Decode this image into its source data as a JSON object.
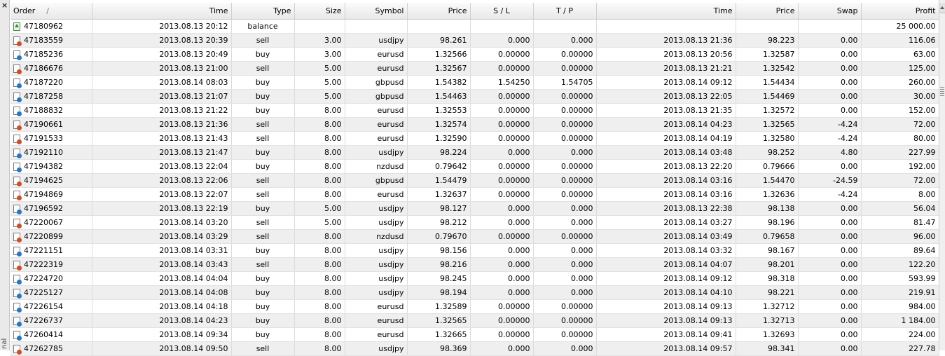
{
  "panel": {
    "close_glyph": "×",
    "side_label": "nal"
  },
  "columns": [
    "Order",
    "Time",
    "Type",
    "Size",
    "Symbol",
    "Price",
    "S / L",
    "T / P",
    "Time",
    "Price",
    "Swap",
    "Profit"
  ],
  "sort_indicator": "/",
  "rows": [
    {
      "icon": "balance",
      "order": "47180962",
      "open_time": "2013.08.13 20:12",
      "type": "balance",
      "size": "",
      "symbol": "",
      "open_price": "",
      "sl": "",
      "tp": "",
      "close_time": "",
      "close_price": "",
      "swap": "",
      "profit": "25 000.00"
    },
    {
      "icon": "sell",
      "order": "47183559",
      "open_time": "2013.08.13 20:39",
      "type": "sell",
      "size": "3.00",
      "symbol": "usdjpy",
      "open_price": "98.261",
      "sl": "0.000",
      "tp": "0.000",
      "close_time": "2013.08.13 21:36",
      "close_price": "98.223",
      "swap": "0.00",
      "profit": "116.06"
    },
    {
      "icon": "buy",
      "order": "47185236",
      "open_time": "2013.08.13 20:49",
      "type": "buy",
      "size": "3.00",
      "symbol": "eurusd",
      "open_price": "1.32566",
      "sl": "0.00000",
      "tp": "0.00000",
      "close_time": "2013.08.13 20:56",
      "close_price": "1.32587",
      "swap": "0.00",
      "profit": "63.00"
    },
    {
      "icon": "sell",
      "order": "47186676",
      "open_time": "2013.08.13 21:00",
      "type": "sell",
      "size": "5.00",
      "symbol": "eurusd",
      "open_price": "1.32567",
      "sl": "0.00000",
      "tp": "0.00000",
      "close_time": "2013.08.13 21:21",
      "close_price": "1.32542",
      "swap": "0.00",
      "profit": "125.00"
    },
    {
      "icon": "buy",
      "order": "47187220",
      "open_time": "2013.08.14 08:03",
      "type": "buy",
      "size": "5.00",
      "symbol": "gbpusd",
      "open_price": "1.54382",
      "sl": "1.54250",
      "tp": "1.54705",
      "close_time": "2013.08.14 09:12",
      "close_price": "1.54434",
      "swap": "0.00",
      "profit": "260.00"
    },
    {
      "icon": "buy",
      "order": "47187258",
      "open_time": "2013.08.13 21:07",
      "type": "buy",
      "size": "5.00",
      "symbol": "gbpusd",
      "open_price": "1.54463",
      "sl": "0.00000",
      "tp": "0.00000",
      "close_time": "2013.08.13 22:05",
      "close_price": "1.54469",
      "swap": "0.00",
      "profit": "30.00"
    },
    {
      "icon": "buy",
      "order": "47188832",
      "open_time": "2013.08.13 21:22",
      "type": "buy",
      "size": "8.00",
      "symbol": "eurusd",
      "open_price": "1.32553",
      "sl": "0.00000",
      "tp": "0.00000",
      "close_time": "2013.08.13 21:35",
      "close_price": "1.32572",
      "swap": "0.00",
      "profit": "152.00"
    },
    {
      "icon": "sell",
      "order": "47190661",
      "open_time": "2013.08.13 21:36",
      "type": "sell",
      "size": "8.00",
      "symbol": "eurusd",
      "open_price": "1.32574",
      "sl": "0.00000",
      "tp": "0.00000",
      "close_time": "2013.08.14 04:23",
      "close_price": "1.32565",
      "swap": "-4.24",
      "profit": "72.00"
    },
    {
      "icon": "sell",
      "order": "47191533",
      "open_time": "2013.08.13 21:43",
      "type": "sell",
      "size": "8.00",
      "symbol": "eurusd",
      "open_price": "1.32590",
      "sl": "0.00000",
      "tp": "0.00000",
      "close_time": "2013.08.14 04:19",
      "close_price": "1.32580",
      "swap": "-4.24",
      "profit": "80.00"
    },
    {
      "icon": "buy",
      "order": "47192110",
      "open_time": "2013.08.13 21:47",
      "type": "buy",
      "size": "8.00",
      "symbol": "usdjpy",
      "open_price": "98.224",
      "sl": "0.000",
      "tp": "0.000",
      "close_time": "2013.08.14 03:48",
      "close_price": "98.252",
      "swap": "4.80",
      "profit": "227.99"
    },
    {
      "icon": "buy",
      "order": "47194382",
      "open_time": "2013.08.13 22:04",
      "type": "buy",
      "size": "8.00",
      "symbol": "nzdusd",
      "open_price": "0.79642",
      "sl": "0.00000",
      "tp": "0.00000",
      "close_time": "2013.08.13 22:20",
      "close_price": "0.79666",
      "swap": "0.00",
      "profit": "192.00"
    },
    {
      "icon": "sell",
      "order": "47194625",
      "open_time": "2013.08.13 22:06",
      "type": "sell",
      "size": "8.00",
      "symbol": "gbpusd",
      "open_price": "1.54479",
      "sl": "0.00000",
      "tp": "0.00000",
      "close_time": "2013.08.14 03:16",
      "close_price": "1.54470",
      "swap": "-24.59",
      "profit": "72.00"
    },
    {
      "icon": "sell",
      "order": "47194869",
      "open_time": "2013.08.13 22:07",
      "type": "sell",
      "size": "8.00",
      "symbol": "eurusd",
      "open_price": "1.32637",
      "sl": "0.00000",
      "tp": "0.00000",
      "close_time": "2013.08.14 03:16",
      "close_price": "1.32636",
      "swap": "-4.24",
      "profit": "8.00"
    },
    {
      "icon": "buy",
      "order": "47196592",
      "open_time": "2013.08.13 22:19",
      "type": "buy",
      "size": "5.00",
      "symbol": "usdjpy",
      "open_price": "98.127",
      "sl": "0.000",
      "tp": "0.000",
      "close_time": "2013.08.13 22:38",
      "close_price": "98.138",
      "swap": "0.00",
      "profit": "56.04"
    },
    {
      "icon": "sell",
      "order": "47220067",
      "open_time": "2013.08.14 03:20",
      "type": "sell",
      "size": "5.00",
      "symbol": "usdjpy",
      "open_price": "98.212",
      "sl": "0.000",
      "tp": "0.000",
      "close_time": "2013.08.14 03:27",
      "close_price": "98.196",
      "swap": "0.00",
      "profit": "81.47"
    },
    {
      "icon": "sell",
      "order": "47220899",
      "open_time": "2013.08.14 03:29",
      "type": "sell",
      "size": "8.00",
      "symbol": "nzdusd",
      "open_price": "0.79670",
      "sl": "0.00000",
      "tp": "0.00000",
      "close_time": "2013.08.14 03:49",
      "close_price": "0.79658",
      "swap": "0.00",
      "profit": "96.00"
    },
    {
      "icon": "buy",
      "order": "47221151",
      "open_time": "2013.08.14 03:31",
      "type": "buy",
      "size": "8.00",
      "symbol": "usdjpy",
      "open_price": "98.156",
      "sl": "0.000",
      "tp": "0.000",
      "close_time": "2013.08.14 03:32",
      "close_price": "98.167",
      "swap": "0.00",
      "profit": "89.64"
    },
    {
      "icon": "sell",
      "order": "47222319",
      "open_time": "2013.08.14 03:43",
      "type": "sell",
      "size": "8.00",
      "symbol": "usdjpy",
      "open_price": "98.216",
      "sl": "0.000",
      "tp": "0.000",
      "close_time": "2013.08.14 04:07",
      "close_price": "98.201",
      "swap": "0.00",
      "profit": "122.20"
    },
    {
      "icon": "buy",
      "order": "47224720",
      "open_time": "2013.08.14 04:04",
      "type": "buy",
      "size": "8.00",
      "symbol": "usdjpy",
      "open_price": "98.245",
      "sl": "0.000",
      "tp": "0.000",
      "close_time": "2013.08.14 09:12",
      "close_price": "98.318",
      "swap": "0.00",
      "profit": "593.99"
    },
    {
      "icon": "buy",
      "order": "47225127",
      "open_time": "2013.08.14 04:08",
      "type": "buy",
      "size": "8.00",
      "symbol": "usdjpy",
      "open_price": "98.194",
      "sl": "0.000",
      "tp": "0.000",
      "close_time": "2013.08.14 04:10",
      "close_price": "98.221",
      "swap": "0.00",
      "profit": "219.91"
    },
    {
      "icon": "buy",
      "order": "47226154",
      "open_time": "2013.08.14 04:18",
      "type": "buy",
      "size": "8.00",
      "symbol": "eurusd",
      "open_price": "1.32589",
      "sl": "0.00000",
      "tp": "0.00000",
      "close_time": "2013.08.14 09:13",
      "close_price": "1.32712",
      "swap": "0.00",
      "profit": "984.00"
    },
    {
      "icon": "buy",
      "order": "47226737",
      "open_time": "2013.08.14 04:23",
      "type": "buy",
      "size": "8.00",
      "symbol": "eurusd",
      "open_price": "1.32565",
      "sl": "0.00000",
      "tp": "0.00000",
      "close_time": "2013.08.14 09:13",
      "close_price": "1.32713",
      "swap": "0.00",
      "profit": "1 184.00"
    },
    {
      "icon": "buy",
      "order": "47260414",
      "open_time": "2013.08.14 09:34",
      "type": "buy",
      "size": "8.00",
      "symbol": "eurusd",
      "open_price": "1.32665",
      "sl": "0.00000",
      "tp": "0.00000",
      "close_time": "2013.08.14 09:41",
      "close_price": "1.32693",
      "swap": "0.00",
      "profit": "224.00"
    },
    {
      "icon": "sell",
      "order": "47262785",
      "open_time": "2013.08.14 09:50",
      "type": "sell",
      "size": "8.00",
      "symbol": "usdjpy",
      "open_price": "98.369",
      "sl": "0.000",
      "tp": "0.000",
      "close_time": "2013.08.14 09:57",
      "close_price": "98.341",
      "swap": "0.00",
      "profit": "227.78"
    }
  ]
}
